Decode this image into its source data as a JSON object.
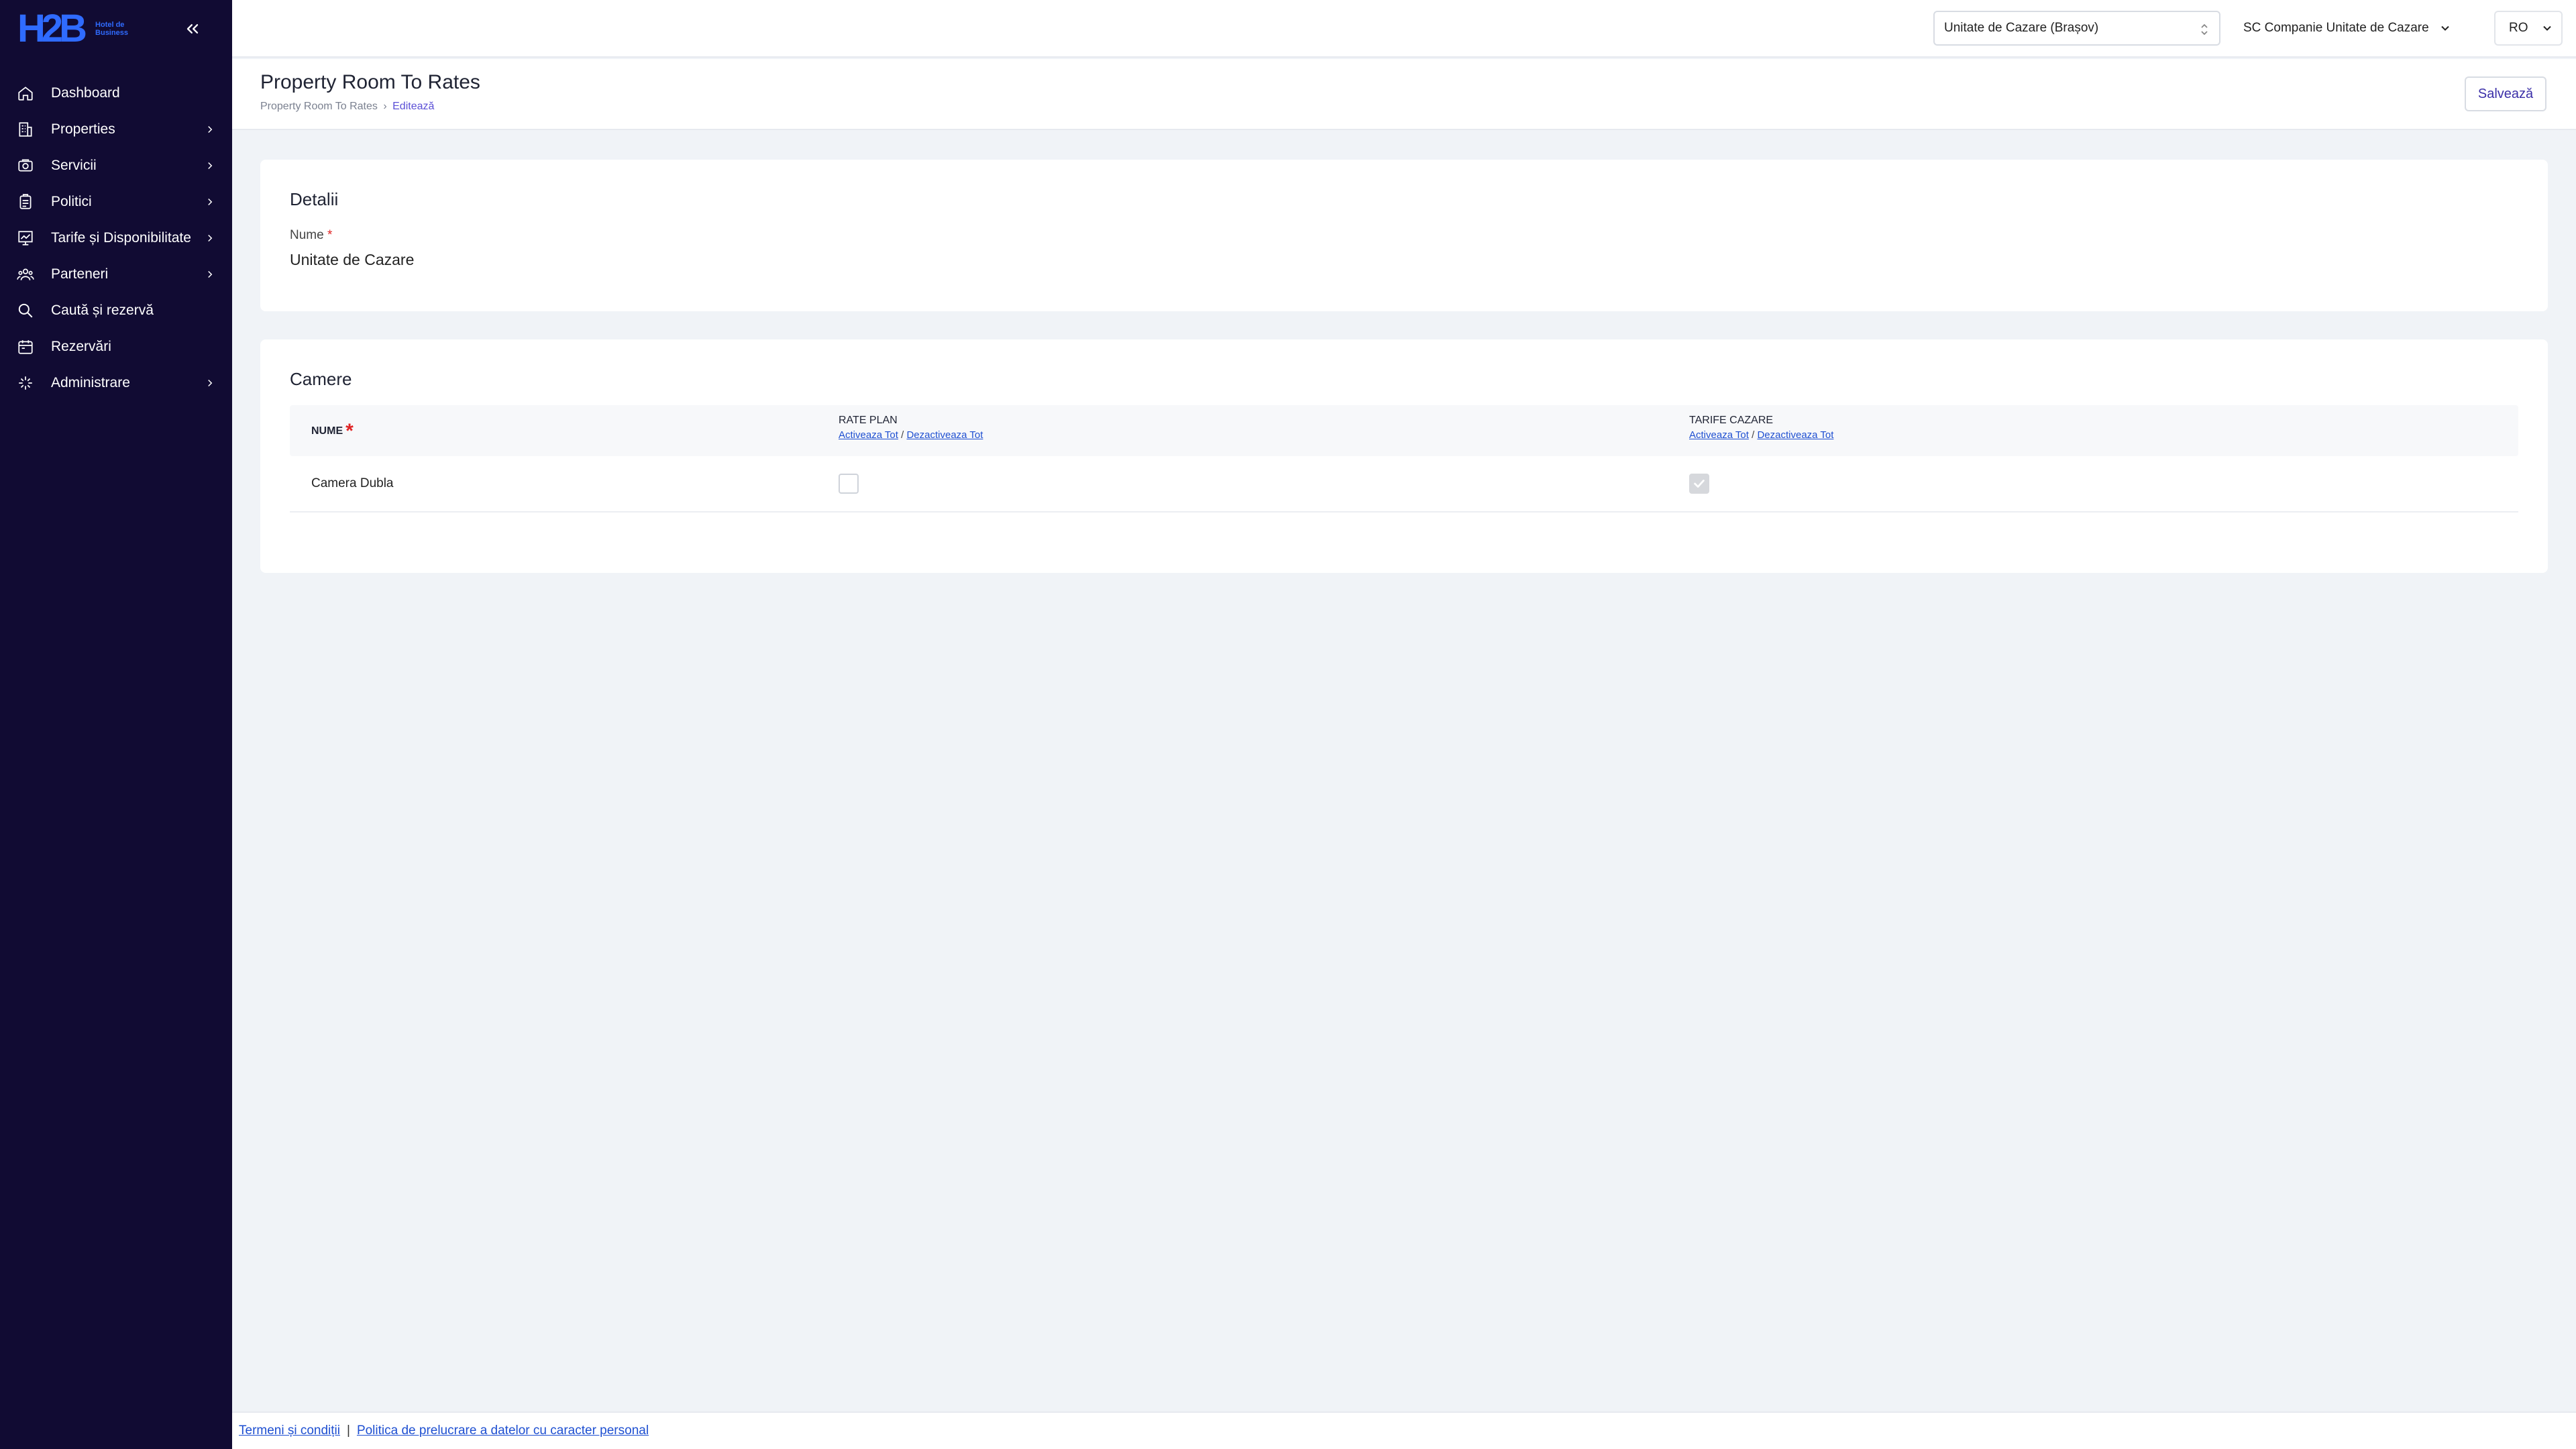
{
  "brand": {
    "logo_mark": "H2B",
    "logo_text": "Hotel de Business",
    "color": "#2f6bff"
  },
  "sidebar": {
    "items": [
      {
        "label": "Dashboard",
        "icon": "home-icon",
        "has_children": false
      },
      {
        "label": "Properties",
        "icon": "building-icon",
        "has_children": true
      },
      {
        "label": "Servicii",
        "icon": "services-icon",
        "has_children": true
      },
      {
        "label": "Politici",
        "icon": "clipboard-icon",
        "has_children": true
      },
      {
        "label": "Tarife și Disponibilitate",
        "icon": "chart-icon",
        "has_children": true
      },
      {
        "label": "Parteneri",
        "icon": "users-icon",
        "has_children": true
      },
      {
        "label": "Caută și rezervă",
        "icon": "search-icon",
        "has_children": false
      },
      {
        "label": "Rezervări",
        "icon": "calendar-icon",
        "has_children": false
      },
      {
        "label": "Administrare",
        "icon": "sparkle-icon",
        "has_children": true
      }
    ]
  },
  "topbar": {
    "property_select": "Unitate de Cazare (Brașov)",
    "company_select": "SC Companie Unitate de Cazare",
    "language": "RO"
  },
  "page": {
    "title": "Property Room To Rates",
    "breadcrumb": {
      "parent": "Property Room To Rates",
      "separator": "›",
      "current": "Editează"
    },
    "save_label": "Salvează"
  },
  "details": {
    "title": "Detalii",
    "name_label": "Nume",
    "required_mark": "*",
    "name_value": "Unitate de Cazare"
  },
  "rooms": {
    "title": "Camere",
    "columns": {
      "name": "NUME",
      "rate_plan": "RATE PLAN",
      "tarife": "TARIFE CAZARE",
      "activate_all": "Activeaza Tot",
      "link_sep": "/",
      "deactivate_all": "Dezactiveaza Tot"
    },
    "rows": [
      {
        "name": "Camera Dubla",
        "rate_plan_checked": false,
        "tarife_checked": true
      }
    ]
  },
  "footer": {
    "terms": "Termeni și condiții",
    "divider": "|",
    "privacy": "Politica de prelucrare a datelor cu caracter personal"
  }
}
